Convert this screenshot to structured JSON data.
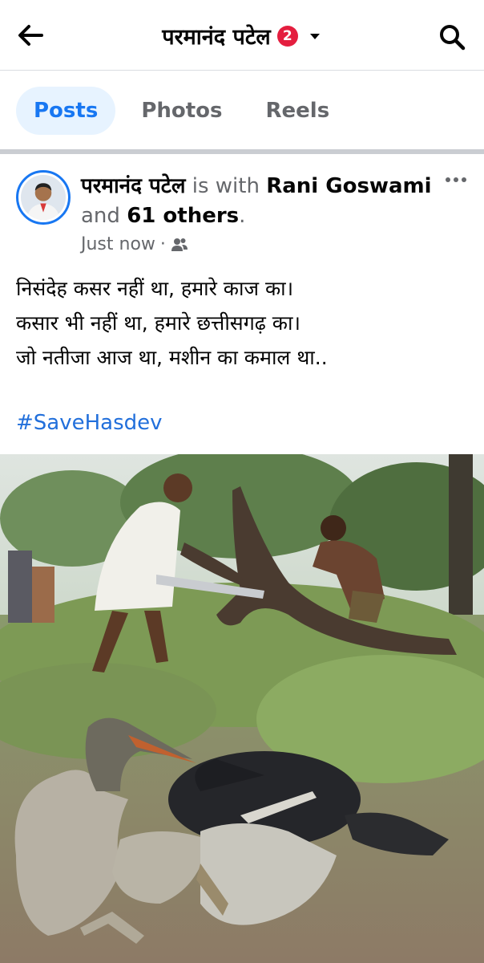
{
  "header": {
    "title": "परमानंद पटेल",
    "badge_count": "2",
    "back_icon": "arrow-left-icon",
    "search_icon": "search-icon"
  },
  "tabs": [
    {
      "label": "Posts",
      "active": true
    },
    {
      "label": "Photos",
      "active": false
    },
    {
      "label": "Reels",
      "active": false
    }
  ],
  "post": {
    "author": "परमानंद पटेल",
    "is_with_text": "is with",
    "tagged_name": "Rani Goswami",
    "and_text": "and",
    "others_text": "61 others",
    "period": ".",
    "timestamp": "Just now",
    "separator": "·",
    "audience_icon": "friends-icon",
    "lines": [
      "निसंदेह कसर नहीं था, हमारे काज का।",
      "कसार भी नहीं था, हमारे छत्तीसगढ़ का।",
      "जो नतीजा आज था, मशीन का कमाल था.."
    ],
    "hashtag": "#SaveHasdev"
  },
  "colors": {
    "accent": "#1877f2",
    "badge": "#e41e3f",
    "tab_active_bg": "#e7f3ff",
    "secondary_text": "#65676b",
    "hashtag": "#216fdb"
  }
}
